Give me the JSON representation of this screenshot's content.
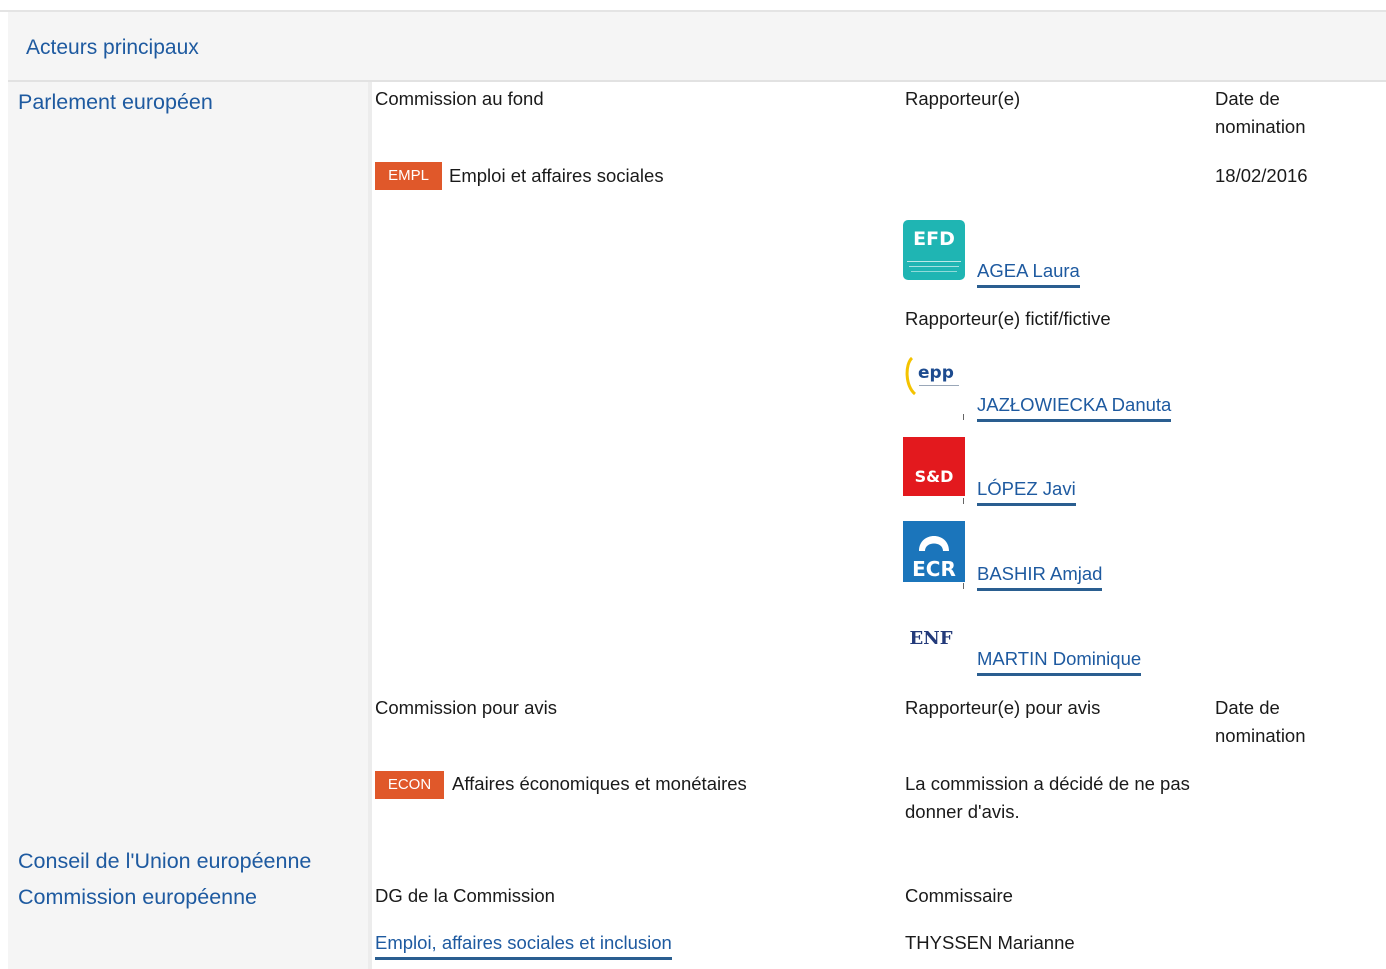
{
  "header": {
    "title": "Acteurs principaux"
  },
  "institutions": {
    "ep": "Parlement européen",
    "council": "Conseil de l'Union européenne",
    "commission": "Commission européenne"
  },
  "ep": {
    "lead": {
      "committee_label": "Commission au fond",
      "rapporteur_label": "Rapporteur(e)",
      "date_label": "Date de nomination",
      "committee_code": "EMPL",
      "committee_name": "Emploi et affaires sociales",
      "date": "18/02/2016",
      "rapporteur": {
        "group_logo": "EFD",
        "name": "AGEA Laura"
      },
      "shadow_label": "Rapporteur(e) fictif/fictive",
      "shadows": [
        {
          "group_logo": "epp",
          "name": "JAZŁOWIECKA Danuta"
        },
        {
          "group_logo": "S&D",
          "name": "LÓPEZ Javi"
        },
        {
          "group_logo": "ECR",
          "name": "BASHIR Amjad"
        },
        {
          "group_logo": "ENF",
          "name": "MARTIN Dominique"
        }
      ]
    },
    "opinion": {
      "committee_label": "Commission pour avis",
      "rapporteur_label": "Rapporteur(e) pour avis",
      "date_label": "Date de nomination",
      "committee_code": "ECON",
      "committee_name": "Affaires économiques et monétaires",
      "note": "La commission a décidé de ne pas donner d'avis."
    }
  },
  "commission": {
    "dg_label": "DG de la Commission",
    "commissioner_label": "Commissaire",
    "dg_name": "Emploi, affaires sociales et inclusion",
    "commissioner": "THYSSEN Marianne"
  },
  "colors": {
    "link": "#1e5aa0",
    "tag": "#e0582a",
    "panel": "#f5f5f5"
  }
}
